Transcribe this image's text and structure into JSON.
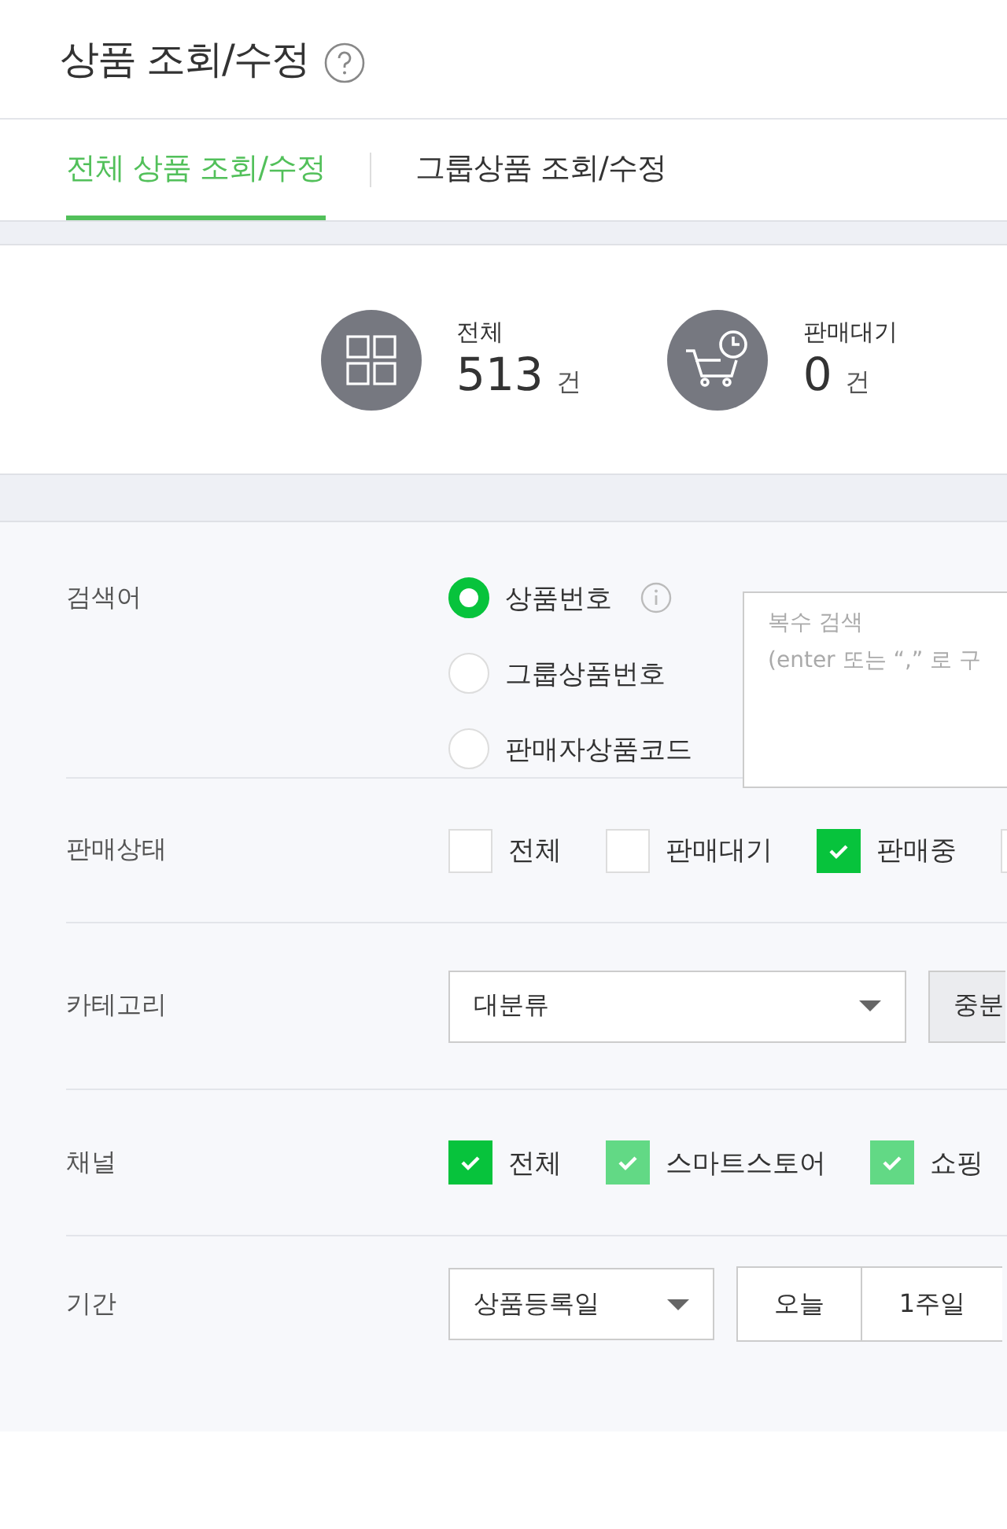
{
  "header": {
    "title": "상품 조회/수정"
  },
  "tabs": [
    {
      "label": "전체 상품 조회/수정",
      "selected": true
    },
    {
      "label": "그룹상품 조회/수정",
      "selected": false
    }
  ],
  "stats": [
    {
      "kind": "grid",
      "label": "전체",
      "count": "513",
      "unit": "건"
    },
    {
      "kind": "cart",
      "label": "판매대기",
      "count": "0",
      "unit": "건"
    }
  ],
  "filters": {
    "search": {
      "label": "검색어",
      "options": [
        {
          "label": "상품번호",
          "selected": true,
          "info": true
        },
        {
          "label": "그룹상품번호",
          "selected": false,
          "info": false
        },
        {
          "label": "판매자상품코드",
          "selected": false,
          "info": false
        }
      ],
      "placeholder": [
        "복수 검색",
        "(enter 또는 “,” 로 구"
      ]
    },
    "status": {
      "label": "판매상태",
      "options": [
        {
          "label": "전체",
          "checked": false
        },
        {
          "label": "판매대기",
          "checked": false
        },
        {
          "label": "판매중",
          "checked": true
        },
        {
          "checked": false
        }
      ]
    },
    "category": {
      "label": "카테고리",
      "selects": [
        {
          "kind": "select",
          "value": "대분류"
        },
        {
          "kind": "disabled",
          "value": "중분"
        }
      ]
    },
    "channel": {
      "label": "채널",
      "options": [
        {
          "label": "전체",
          "checked": true,
          "disabled": false
        },
        {
          "label": "스마트스토어",
          "checked": true,
          "disabled": true
        },
        {
          "label": "쇼핑",
          "checked": true,
          "disabled": true
        }
      ]
    },
    "period": {
      "label": "기간",
      "select": "상품등록일",
      "buttons": [
        "오늘",
        "1주일"
      ]
    }
  }
}
